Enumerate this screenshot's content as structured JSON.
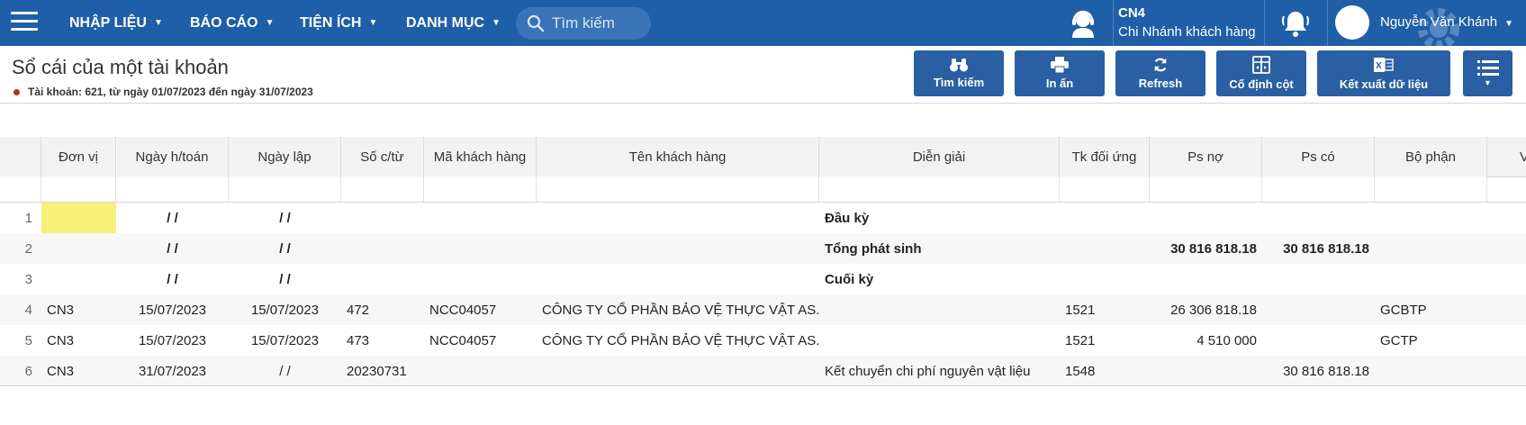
{
  "nav": {
    "menu": [
      "NHẬP LIỆU",
      "BÁO CÁO",
      "TIỆN ÍCH",
      "DANH MỤC"
    ],
    "search_placeholder": "Tìm kiếm",
    "branch_code": "CN4",
    "branch_name": "Chi Nhánh khách hàng",
    "user_name": "Nguyễn Văn Khánh"
  },
  "page": {
    "title": "Sổ cái của một tài khoản",
    "subtitle": "Tài khoản: 621, từ ngày 01/07/2023 đến ngày 31/07/2023"
  },
  "toolbar": {
    "search": "Tìm kiếm",
    "print": "In ấn",
    "refresh": "Refresh",
    "freeze": "Cố định cột",
    "export": "Kết xuất dữ liệu"
  },
  "table": {
    "columns": [
      "Đơn vị",
      "Ngày h/toán",
      "Ngày lập",
      "Số c/từ",
      "Mã khách hàng",
      "Tên khách hàng",
      "Diễn giải",
      "Tk đối ứng",
      "Ps nợ",
      "Ps có",
      "Bộ phận",
      "V"
    ],
    "rows": [
      {
        "no": "1",
        "unit": "",
        "post_date": "/ /",
        "doc_date": "/ /",
        "doc_no": "",
        "cust_code": "",
        "cust_name": "",
        "desc": "Đầu kỳ",
        "contra": "",
        "debit": "",
        "credit": "",
        "dept": ""
      },
      {
        "no": "2",
        "unit": "",
        "post_date": "/ /",
        "doc_date": "/ /",
        "doc_no": "",
        "cust_code": "",
        "cust_name": "",
        "desc": "Tổng phát sinh",
        "contra": "",
        "debit": "30 816 818.18",
        "credit": "30 816 818.18",
        "dept": ""
      },
      {
        "no": "3",
        "unit": "",
        "post_date": "/ /",
        "doc_date": "/ /",
        "doc_no": "",
        "cust_code": "",
        "cust_name": "",
        "desc": "Cuối kỳ",
        "contra": "",
        "debit": "",
        "credit": "",
        "dept": ""
      },
      {
        "no": "4",
        "unit": "CN3",
        "post_date": "15/07/2023",
        "doc_date": "15/07/2023",
        "doc_no": "472",
        "cust_code": "NCC04057",
        "cust_name": "CÔNG TY CỔ PHẦN BẢO VỆ THỰC VẬT AS...",
        "desc": "",
        "contra": "1521",
        "debit": "26 306 818.18",
        "credit": "",
        "dept": "GCBTP"
      },
      {
        "no": "5",
        "unit": "CN3",
        "post_date": "15/07/2023",
        "doc_date": "15/07/2023",
        "doc_no": "473",
        "cust_code": "NCC04057",
        "cust_name": "CÔNG TY CỔ PHẦN BẢO VỆ THỰC VẬT AS...",
        "desc": "",
        "contra": "1521",
        "debit": "4 510 000",
        "credit": "",
        "dept": "GCTP"
      },
      {
        "no": "6",
        "unit": "CN3",
        "post_date": "31/07/2023",
        "doc_date": "/ /",
        "doc_no": "20230731",
        "cust_code": "",
        "cust_name": "",
        "desc": "Kết chuyển chi phí nguyên vật liệu",
        "contra": "1548",
        "debit": "",
        "credit": "30 816 818.18",
        "dept": ""
      }
    ]
  },
  "colors": {
    "nav_bg": "#1f5fa8",
    "button_bg": "#2a5fa3",
    "highlight_cell": "#f7f17a"
  }
}
